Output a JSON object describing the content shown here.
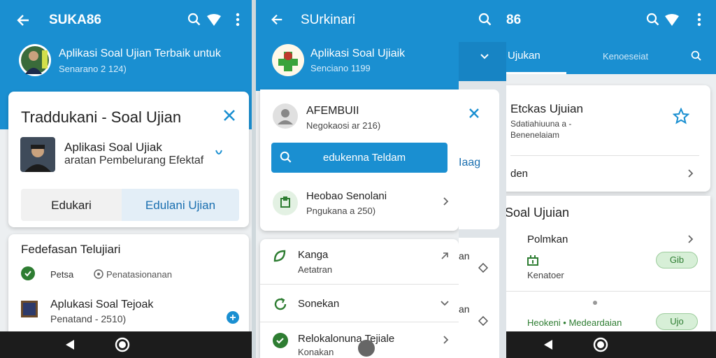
{
  "screen1": {
    "title": "SUKA86",
    "profile_title": "Aplikasi Soal Ujian Terbaik untuk",
    "profile_sub": "Senarano 2 124)",
    "card_title": "Traddukani - Soal Ujian",
    "app_name": "Aplikasi Soal Ujiak",
    "app_desc": "aratan Pembelurang Efektaf",
    "tab_left": "Edukari",
    "tab_right": "Edulani Ujian",
    "section_title": "Fedefasan Telujiari",
    "row1_label": "Petsa",
    "row1_value": "Penatasionanan",
    "item_title": "Aplukasi Soal Tejoak",
    "item_sub": "Penatand - 2510)"
  },
  "screen2": {
    "title": "SUrkinari",
    "profile_title": "Aplikasi Soal Ujiaik",
    "profile_sub": "Senciano 1199",
    "user_name": "AFEMBUII",
    "user_sub": "Negokaosi ar 216)",
    "button_label": "edukenna Teldam",
    "row1_title": "Heobao Senolani",
    "row1_sub": "Pngukana a 250)",
    "row2_title": "Kanga",
    "row2_sub": "Aetatran",
    "row3_title": "Sonekan",
    "row4_title": "Relokalonuna Tejiale",
    "row4_sub": "Konakan"
  },
  "peek": {
    "text1": "Iaag",
    "text2": "an",
    "text3": "an"
  },
  "screen3": {
    "title": "86",
    "tab_active": "Ujukan",
    "tab_inactive": "Kenoeseiat",
    "card_title": "Etckas Ujuian",
    "card_sub1": "Sdatiahiuuna a -",
    "card_sub2": "Benenelaiam",
    "row1": "den",
    "section_title": "Soal Ujuian",
    "row2_title": "Polmkan",
    "row2_sub": "Kenatoer",
    "pill1": "Gib",
    "row3_text": "Heokeni • Medeardaian",
    "pill2": "Ujo"
  },
  "colors": {
    "primary": "#1a8fd1",
    "dark_nav": "#1c1c1c",
    "accent_green": "#2e7d32",
    "tab_selected_bg": "#e3eef7"
  }
}
